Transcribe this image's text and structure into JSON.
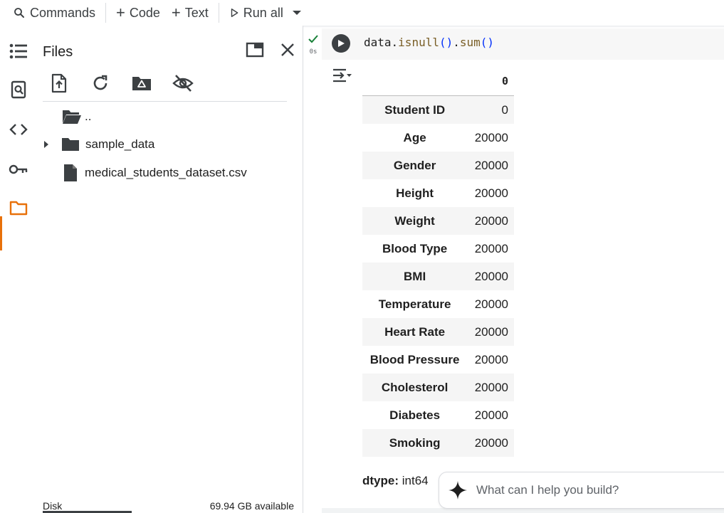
{
  "toolbar": {
    "commands_label": "Commands",
    "code_label": "Code",
    "text_label": "Text",
    "run_all_label": "Run all"
  },
  "files_panel": {
    "title": "Files",
    "tree": [
      {
        "name": "..",
        "type": "parent"
      },
      {
        "name": "sample_data",
        "type": "folder"
      },
      {
        "name": "medical_students_dataset.csv",
        "type": "file"
      }
    ],
    "disk_label": "Disk",
    "disk_available": "69.94 GB available"
  },
  "cell": {
    "exec_time": "0s",
    "code": {
      "obj": "data.",
      "fn1": "isnull",
      "p1": "()",
      "dot": ".",
      "fn2": "sum",
      "p2": "()"
    },
    "output": {
      "column_header": "0",
      "rows": [
        {
          "label": "Student ID",
          "value": "0"
        },
        {
          "label": "Age",
          "value": "20000"
        },
        {
          "label": "Gender",
          "value": "20000"
        },
        {
          "label": "Height",
          "value": "20000"
        },
        {
          "label": "Weight",
          "value": "20000"
        },
        {
          "label": "Blood Type",
          "value": "20000"
        },
        {
          "label": "BMI",
          "value": "20000"
        },
        {
          "label": "Temperature",
          "value": "20000"
        },
        {
          "label": "Heart Rate",
          "value": "20000"
        },
        {
          "label": "Blood Pressure",
          "value": "20000"
        },
        {
          "label": "Cholesterol",
          "value": "20000"
        },
        {
          "label": "Diabetes",
          "value": "20000"
        },
        {
          "label": "Smoking",
          "value": "20000"
        }
      ],
      "dtype_label": "dtype:",
      "dtype_value": "int64"
    }
  },
  "ai_prompt": {
    "placeholder": "What can I help you build?"
  },
  "colors": {
    "accent": "#e8710a",
    "success": "#188038",
    "icon": "#3c4043"
  }
}
